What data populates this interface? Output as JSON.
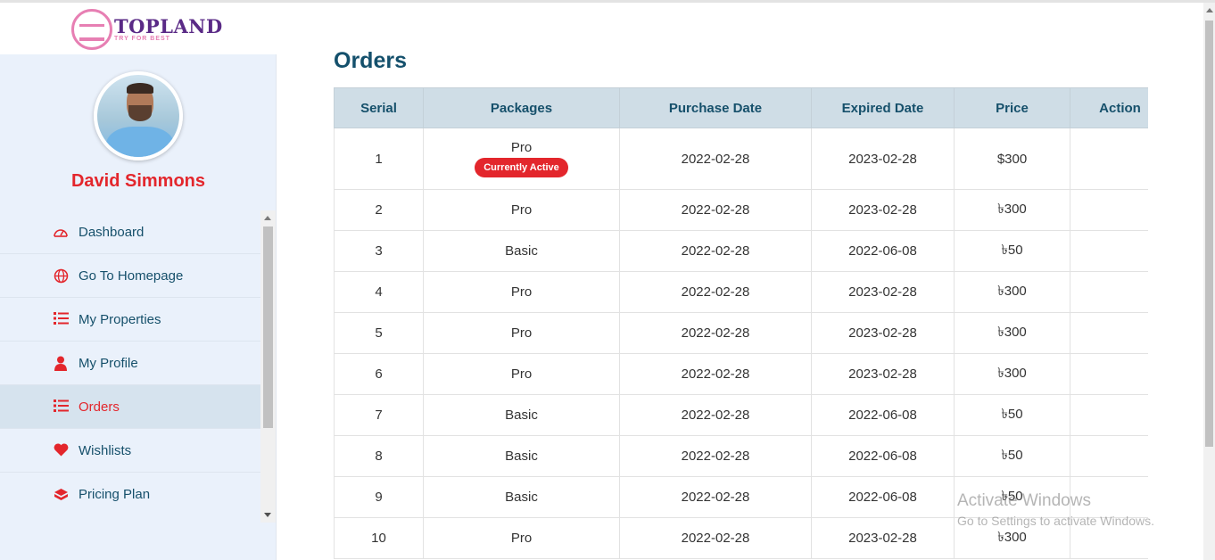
{
  "brand": {
    "name": "TOPLAND",
    "tagline": "TRY FOR BEST"
  },
  "user": {
    "name": "David Simmons"
  },
  "sidebar": {
    "items": [
      {
        "label": "Dashboard",
        "icon": "speedometer-icon",
        "active": false
      },
      {
        "label": "Go To Homepage",
        "icon": "globe-icon",
        "active": false
      },
      {
        "label": "My Properties",
        "icon": "list-icon",
        "active": false
      },
      {
        "label": "My Profile",
        "icon": "user-icon",
        "active": false
      },
      {
        "label": "Orders",
        "icon": "list-icon",
        "active": true
      },
      {
        "label": "Wishlists",
        "icon": "heart-icon",
        "active": false
      },
      {
        "label": "Pricing Plan",
        "icon": "package-icon",
        "active": false
      }
    ]
  },
  "main": {
    "title": "Orders",
    "columns": [
      "Serial",
      "Packages",
      "Purchase Date",
      "Expired Date",
      "Price",
      "Action"
    ],
    "active_badge": "Currently Active",
    "rows": [
      {
        "serial": "1",
        "package": "Pro",
        "purchase": "2022-02-28",
        "expired": "2023-02-28",
        "price": "$300",
        "active": true
      },
      {
        "serial": "2",
        "package": "Pro",
        "purchase": "2022-02-28",
        "expired": "2023-02-28",
        "price": "৳300",
        "active": false
      },
      {
        "serial": "3",
        "package": "Basic",
        "purchase": "2022-02-28",
        "expired": "2022-06-08",
        "price": "৳50",
        "active": false
      },
      {
        "serial": "4",
        "package": "Pro",
        "purchase": "2022-02-28",
        "expired": "2023-02-28",
        "price": "৳300",
        "active": false
      },
      {
        "serial": "5",
        "package": "Pro",
        "purchase": "2022-02-28",
        "expired": "2023-02-28",
        "price": "৳300",
        "active": false
      },
      {
        "serial": "6",
        "package": "Pro",
        "purchase": "2022-02-28",
        "expired": "2023-02-28",
        "price": "৳300",
        "active": false
      },
      {
        "serial": "7",
        "package": "Basic",
        "purchase": "2022-02-28",
        "expired": "2022-06-08",
        "price": "৳50",
        "active": false
      },
      {
        "serial": "8",
        "package": "Basic",
        "purchase": "2022-02-28",
        "expired": "2022-06-08",
        "price": "৳50",
        "active": false
      },
      {
        "serial": "9",
        "package": "Basic",
        "purchase": "2022-02-28",
        "expired": "2022-06-08",
        "price": "৳50",
        "active": false
      },
      {
        "serial": "10",
        "package": "Pro",
        "purchase": "2022-02-28",
        "expired": "2023-02-28",
        "price": "৳300",
        "active": false
      }
    ]
  },
  "watermark": {
    "title": "Activate Windows",
    "subtitle": "Go to Settings to activate Windows."
  },
  "colors": {
    "accent": "#e3262c",
    "heading": "#14506c",
    "sidebar_bg": "#eaf1fb",
    "table_header_bg": "#cfdde6"
  }
}
